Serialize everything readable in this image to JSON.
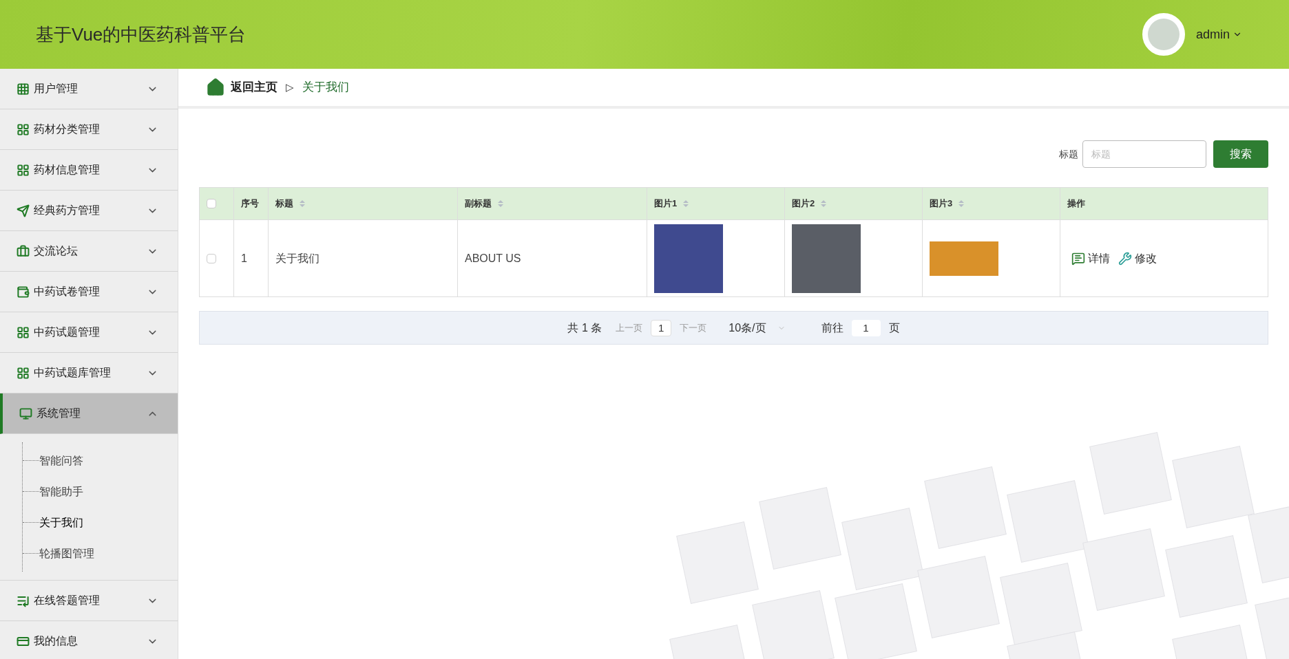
{
  "header": {
    "title": "基于Vue的中医药科普平台",
    "user": "admin"
  },
  "sidebar": {
    "items": [
      {
        "label": "用户管理",
        "expanded": false,
        "selected": false
      },
      {
        "label": "药材分类管理",
        "expanded": false,
        "selected": false
      },
      {
        "label": "药材信息管理",
        "expanded": false,
        "selected": false
      },
      {
        "label": "经典药方管理",
        "expanded": false,
        "selected": false
      },
      {
        "label": "交流论坛",
        "expanded": false,
        "selected": false
      },
      {
        "label": "中药试卷管理",
        "expanded": false,
        "selected": false
      },
      {
        "label": "中药试题管理",
        "expanded": false,
        "selected": false
      },
      {
        "label": "中药试题库管理",
        "expanded": false,
        "selected": false
      },
      {
        "label": "系统管理",
        "expanded": true,
        "selected": true,
        "children": [
          {
            "label": "智能问答",
            "selected": false
          },
          {
            "label": "智能助手",
            "selected": false
          },
          {
            "label": "关于我们",
            "selected": true
          },
          {
            "label": "轮播图管理",
            "selected": false
          }
        ]
      },
      {
        "label": "在线答题管理",
        "expanded": false,
        "selected": false
      },
      {
        "label": "我的信息",
        "expanded": false,
        "selected": false
      }
    ]
  },
  "breadcrumb": {
    "home": "返回主页",
    "separator": "▷",
    "current": "关于我们"
  },
  "search": {
    "label": "标题",
    "placeholder": "标题",
    "button": "搜索"
  },
  "table": {
    "all_checked": false,
    "columns": [
      {
        "kind": "check",
        "sortable": false
      },
      {
        "kind": "text",
        "label": "序号",
        "sortable": false
      },
      {
        "kind": "text",
        "label": "标题",
        "sortable": true
      },
      {
        "kind": "text",
        "label": "副标题",
        "sortable": true
      },
      {
        "kind": "image",
        "label": "图片1",
        "sortable": true
      },
      {
        "kind": "image",
        "label": "图片2",
        "sortable": true
      },
      {
        "kind": "image",
        "label": "图片3",
        "sortable": true
      },
      {
        "kind": "actions",
        "label": "操作",
        "sortable": false
      }
    ],
    "rows": [
      {
        "checked": false,
        "index": "1",
        "title": "关于我们",
        "subtitle": "ABOUT US",
        "actions": [
          "详情",
          "修改"
        ]
      }
    ]
  },
  "pagination": {
    "total": "共 1 条",
    "prev": "上一页",
    "page": "1",
    "next": "下一页",
    "page_size": "10条/页",
    "goto_label": "前往",
    "goto_value": "1",
    "goto_suffix": "页"
  }
}
